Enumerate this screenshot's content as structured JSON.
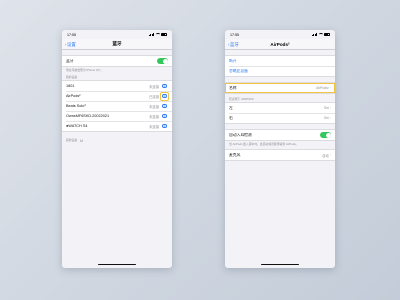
{
  "left_phone": {
    "status_time": "17:55",
    "nav_back": "设置",
    "nav_title": "蓝牙",
    "bluetooth_label": "蓝牙",
    "bluetooth_footnote": "现在可被发现为“iPhone (5)”。",
    "my_devices_header": "我的设备",
    "devices": [
      {
        "name": "1801",
        "status": "未连接"
      },
      {
        "name": "AirPods²",
        "status": "已连接"
      },
      {
        "name": "Beats Solo³",
        "status": "未连接"
      },
      {
        "name": "OwnsMF6SKD.20022021",
        "status": "未连接"
      },
      {
        "name": "●WATCH S4",
        "status": "未连接"
      }
    ],
    "other_devices_header": "其他设备"
  },
  "right_phone": {
    "status_time": "17:55",
    "nav_back": "蓝牙",
    "nav_title": "AirPods²",
    "disconnect": "断开",
    "forget": "忽略此设备",
    "name_label": "名称",
    "name_value": "AirPods²",
    "press_hold_header": "轻点两下 AIRPODS",
    "left_label": "左",
    "left_value": "Siri",
    "right_label": "右",
    "right_value": "Siri",
    "ear_detect_label": "自动入耳检测",
    "ear_detect_footnote": "当 AirPods 戴入耳中时，会自动将音频传输到 AirPods。",
    "mic_label": "麦克风",
    "mic_value": "自动"
  },
  "colors": {
    "accent": "#2f7cf6",
    "toggle_on": "#34c759",
    "highlight": "#f4c542"
  }
}
